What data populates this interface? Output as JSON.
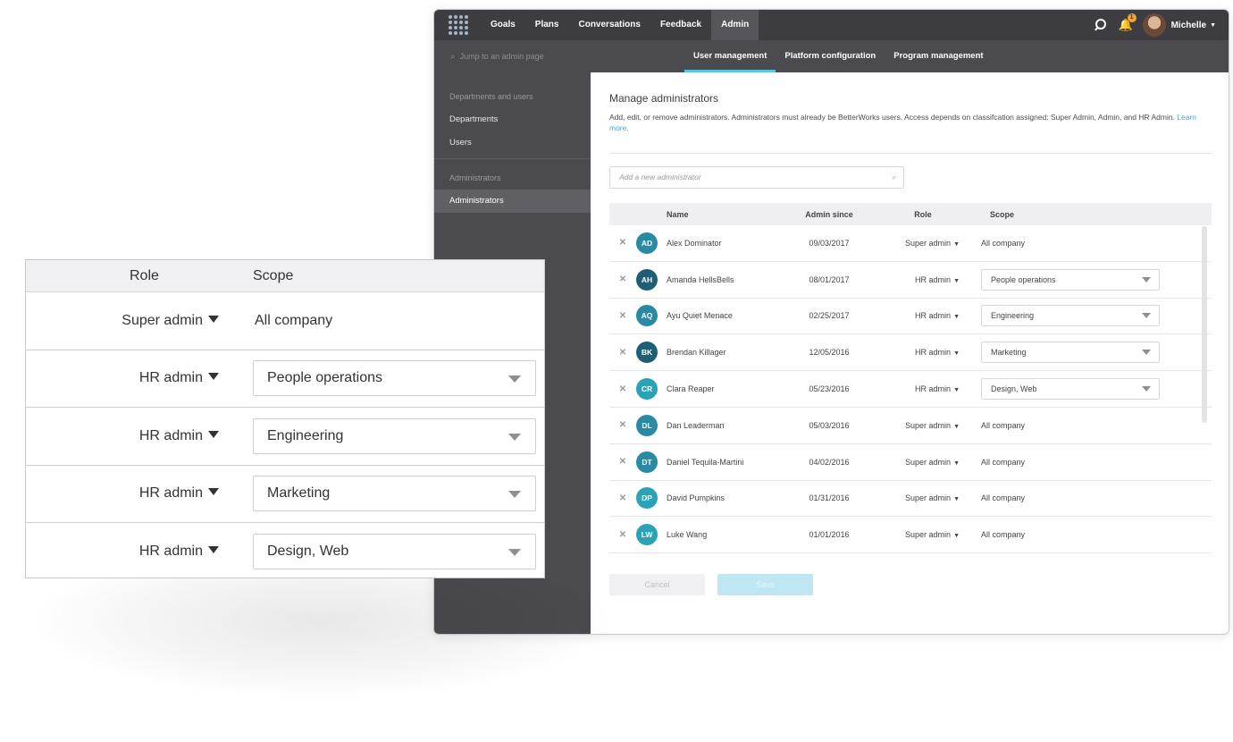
{
  "topnav": {
    "items": [
      "Goals",
      "Plans",
      "Conversations",
      "Feedback",
      "Admin"
    ],
    "active": "Admin",
    "notification_count": "1",
    "user_name": "Michelle"
  },
  "subnav": {
    "search_placeholder": "Jump to an admin page",
    "tabs": [
      "User management",
      "Platform configuration",
      "Program management"
    ],
    "active": "User management"
  },
  "sidebar": {
    "section1": "Departments and users",
    "items1": [
      "Departments",
      "Users"
    ],
    "section2": "Administrators",
    "items2": [
      "Administrators"
    ]
  },
  "main": {
    "title": "Manage administrators",
    "description": "Add, edit, or remove administrators. Administrators must already be BetterWorks users. Access depends on classifcation assigned: Super Admin, Admin, and HR Admin.",
    "learn_more": "Learn more.",
    "add_placeholder": "Add a new administrator",
    "columns": {
      "name": "Name",
      "since": "Admin since",
      "role": "Role",
      "scope": "Scope"
    },
    "rows": [
      {
        "initials": "AD",
        "name": "Alex Dominator",
        "since": "09/03/2017",
        "role": "Super admin",
        "scope": "All company",
        "scope_select": false,
        "color": "#2a8aa3"
      },
      {
        "initials": "AH",
        "name": "Amanda HellsBells",
        "since": "08/01/2017",
        "role": "HR admin",
        "scope": "People operations",
        "scope_select": true,
        "color": "#1e5f73"
      },
      {
        "initials": "AQ",
        "name": "Ayu Quiet Menace",
        "since": "02/25/2017",
        "role": "HR admin",
        "scope": "Engineering",
        "scope_select": true,
        "color": "#2a8aa3"
      },
      {
        "initials": "BK",
        "name": "Brendan Killager",
        "since": "12/05/2016",
        "role": "HR admin",
        "scope": "Marketing",
        "scope_select": true,
        "color": "#1e5f73"
      },
      {
        "initials": "CR",
        "name": "Clara Reaper",
        "since": "05/23/2016",
        "role": "HR admin",
        "scope": "Design, Web",
        "scope_select": true,
        "color": "#2aa3b8"
      },
      {
        "initials": "DL",
        "name": "Dan Leaderman",
        "since": "05/03/2016",
        "role": "Super admin",
        "scope": "All company",
        "scope_select": false,
        "color": "#2a8aa3"
      },
      {
        "initials": "DT",
        "name": "Daniel Tequila-Martini",
        "since": "04/02/2016",
        "role": "Super admin",
        "scope": "All company",
        "scope_select": false,
        "color": "#2a8aa3"
      },
      {
        "initials": "DP",
        "name": "David Pumpkins",
        "since": "01/31/2016",
        "role": "Super admin",
        "scope": "All company",
        "scope_select": false,
        "color": "#2aa3b8"
      },
      {
        "initials": "LW",
        "name": "Luke Wang",
        "since": "01/01/2016",
        "role": "Super admin",
        "scope": "All company",
        "scope_select": false,
        "color": "#2aa3b8"
      }
    ],
    "cancel_label": "Cancel",
    "save_label": "Save"
  },
  "zoom": {
    "role_header": "Role",
    "scope_header": "Scope",
    "rows": [
      {
        "role": "Super admin",
        "scope": "All company",
        "scope_select": false
      },
      {
        "role": "HR admin",
        "scope": "People operations",
        "scope_select": true
      },
      {
        "role": "HR admin",
        "scope": "Engineering",
        "scope_select": true
      },
      {
        "role": "HR admin",
        "scope": "Marketing",
        "scope_select": true
      },
      {
        "role": "HR admin",
        "scope": "Design, Web",
        "scope_select": true
      }
    ]
  }
}
